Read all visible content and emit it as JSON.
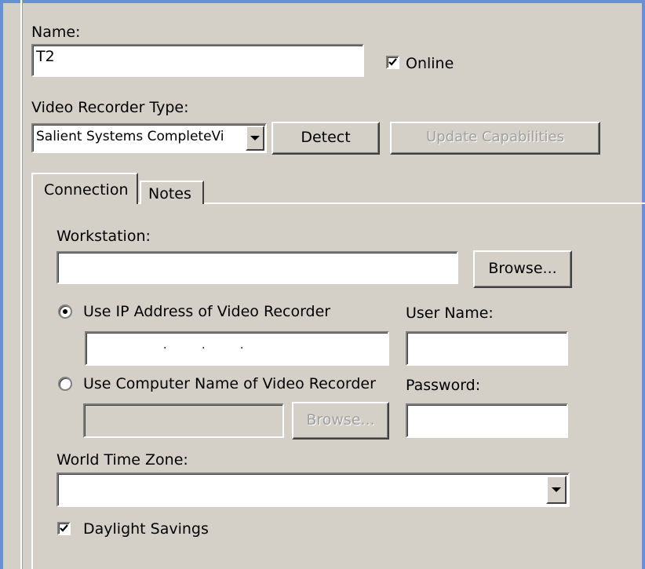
{
  "name": {
    "label": "Name:",
    "value": "T2"
  },
  "online": {
    "label": "Online",
    "checked": true
  },
  "recorder_type": {
    "label": "Video Recorder Type:",
    "value": "Salient Systems CompleteVi",
    "detect_label": "Detect",
    "update_label": "Update Capabilities"
  },
  "tabs": [
    {
      "label": "Connection",
      "active": true
    },
    {
      "label": "Notes",
      "active": false
    }
  ],
  "connection": {
    "workstation_label": "Workstation:",
    "workstation_value": "",
    "browse_label": "Browse...",
    "use_ip_label": "Use IP Address of Video Recorder",
    "use_ip_selected": true,
    "ip_value": ".          .          .",
    "use_name_label": "Use Computer Name of Video Recorder",
    "use_name_selected": false,
    "computer_name_value": "",
    "name_browse_label": "Browse...",
    "username_label": "User Name:",
    "username_value": "",
    "password_label": "Password:",
    "password_value": "",
    "timezone_label": "World Time Zone:",
    "timezone_value": "",
    "daylight_label": "Daylight Savings",
    "daylight_checked": true
  }
}
